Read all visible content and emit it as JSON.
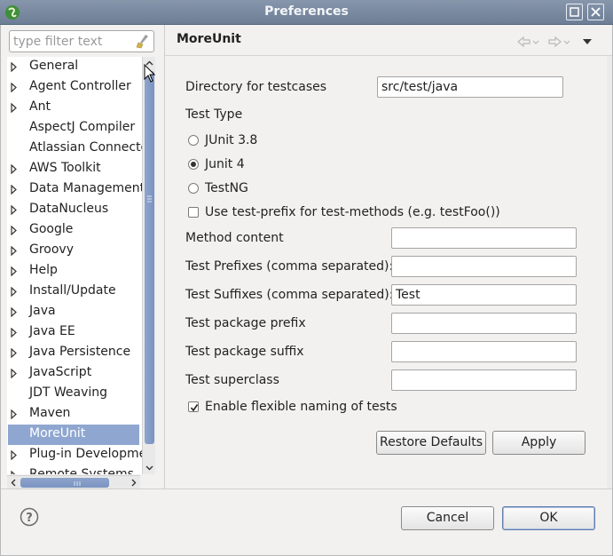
{
  "window": {
    "title": "Preferences",
    "accent": "#8fa7d0"
  },
  "filter": {
    "placeholder": "type filter text"
  },
  "tree": {
    "items": [
      {
        "label": "General",
        "expandable": true
      },
      {
        "label": "Agent Controller",
        "expandable": true
      },
      {
        "label": "Ant",
        "expandable": true
      },
      {
        "label": "AspectJ Compiler",
        "expandable": false
      },
      {
        "label": "Atlassian Connector",
        "expandable": false
      },
      {
        "label": "AWS Toolkit",
        "expandable": true
      },
      {
        "label": "Data Management",
        "expandable": true
      },
      {
        "label": "DataNucleus",
        "expandable": true
      },
      {
        "label": "Google",
        "expandable": true
      },
      {
        "label": "Groovy",
        "expandable": true
      },
      {
        "label": "Help",
        "expandable": true
      },
      {
        "label": "Install/Update",
        "expandable": true
      },
      {
        "label": "Java",
        "expandable": true
      },
      {
        "label": "Java EE",
        "expandable": true
      },
      {
        "label": "Java Persistence",
        "expandable": true
      },
      {
        "label": "JavaScript",
        "expandable": true
      },
      {
        "label": "JDT Weaving",
        "expandable": false
      },
      {
        "label": "Maven",
        "expandable": true
      },
      {
        "label": "MoreUnit",
        "expandable": false,
        "selected": true
      },
      {
        "label": "Plug-in Development",
        "expandable": true
      },
      {
        "label": "Remote Systems",
        "expandable": true
      }
    ]
  },
  "page": {
    "title": "MoreUnit",
    "directory_label": "Directory for testcases",
    "directory_value": "src/test/java",
    "test_type_label": "Test Type",
    "radios": [
      {
        "label": "JUnit 3.8",
        "checked": false
      },
      {
        "label": "Junit 4",
        "checked": true
      },
      {
        "label": "TestNG",
        "checked": false
      }
    ],
    "prefix_methods_label": "Use test-prefix for test-methods (e.g. testFoo())",
    "prefix_methods_checked": false,
    "method_content_label": "Method content",
    "method_content_value": "",
    "prefixes_label": "Test Prefixes (comma separated):",
    "prefixes_value": "",
    "suffixes_label": "Test Suffixes (comma separated):",
    "suffixes_value": "Test",
    "package_prefix_label": "Test package prefix",
    "package_prefix_value": "",
    "package_suffix_label": "Test package suffix",
    "package_suffix_value": "",
    "superclass_label": "Test superclass",
    "superclass_value": "",
    "flexible_naming_label": "Enable flexible naming of tests",
    "flexible_naming_checked": true,
    "restore_defaults": "Restore Defaults",
    "apply": "Apply"
  },
  "footer": {
    "cancel": "Cancel",
    "ok": "OK"
  }
}
